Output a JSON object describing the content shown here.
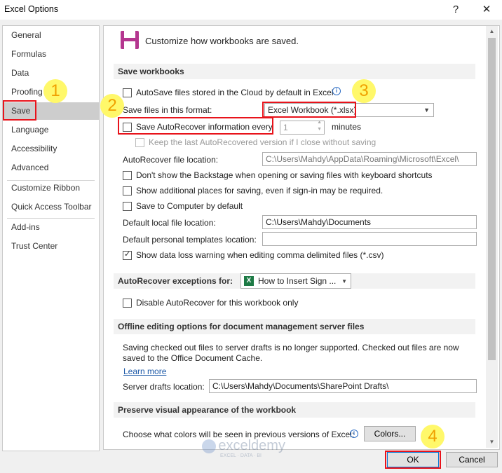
{
  "window": {
    "title": "Excel Options",
    "help_label": "?",
    "close_label": "✕"
  },
  "sidebar": {
    "items": [
      {
        "label": "General"
      },
      {
        "label": "Formulas"
      },
      {
        "label": "Data"
      },
      {
        "label": "Proofing"
      },
      {
        "label": "Save"
      },
      {
        "label": "Language"
      },
      {
        "label": "Accessibility"
      },
      {
        "label": "Advanced"
      },
      {
        "label": "Customize Ribbon"
      },
      {
        "label": "Quick Access Toolbar"
      },
      {
        "label": "Add-ins"
      },
      {
        "label": "Trust Center"
      }
    ],
    "selected": "Save"
  },
  "header": {
    "text": "Customize how workbooks are saved."
  },
  "save_workbooks": {
    "title": "Save workbooks",
    "autosave_label": "AutoSave files stored in the Cloud by default in Excel",
    "format_label": "Save files in this format:",
    "format_value": "Excel Workbook (*.xlsx)",
    "autorecover_label": "Save AutoRecover information every",
    "autorecover_minutes": "1",
    "minutes_label": "minutes",
    "keep_last_label": "Keep the last AutoRecovered version if I close without saving",
    "ar_location_label": "AutoRecover file location:",
    "ar_location_value": "C:\\Users\\Mahdy\\AppData\\Roaming\\Microsoft\\Excel\\",
    "backstage_label": "Don't show the Backstage when opening or saving files with keyboard shortcuts",
    "additional_places_label": "Show additional places for saving, even if sign-in may be required.",
    "save_to_computer_label": "Save to Computer by default",
    "default_local_label": "Default local file location:",
    "default_local_value": "C:\\Users\\Mahdy\\Documents",
    "personal_templates_label": "Default personal templates location:",
    "personal_templates_value": "",
    "data_loss_label": "Show data loss warning when editing comma delimited files (*.csv)"
  },
  "ar_exceptions": {
    "title": "AutoRecover exceptions for:",
    "workbook": "How to Insert Sign ...",
    "disable_label": "Disable AutoRecover for this workbook only"
  },
  "offline": {
    "title": "Offline editing options for document management server files",
    "line1": "Saving checked out files to server drafts is no longer supported. Checked out files are now",
    "line2": "saved to the Office Document Cache.",
    "learn_more": "Learn more",
    "drafts_label": "Server drafts location:",
    "drafts_value": "C:\\Users\\Mahdy\\Documents\\SharePoint Drafts\\"
  },
  "preserve": {
    "title": "Preserve visual appearance of the workbook",
    "colors_label": "Choose what colors will be seen in previous versions of Excel:",
    "colors_button": "Colors..."
  },
  "footer": {
    "ok_label": "OK",
    "cancel_label": "Cancel"
  },
  "watermark": {
    "brand": "exceldemy",
    "tagline": "EXCEL · DATA · BI"
  },
  "annotations": [
    "1",
    "2",
    "3",
    "4"
  ],
  "colors": {
    "highlight_red": "#e8131b",
    "marker_yellow": "#fff86a",
    "marker_text": "#f0a000"
  }
}
